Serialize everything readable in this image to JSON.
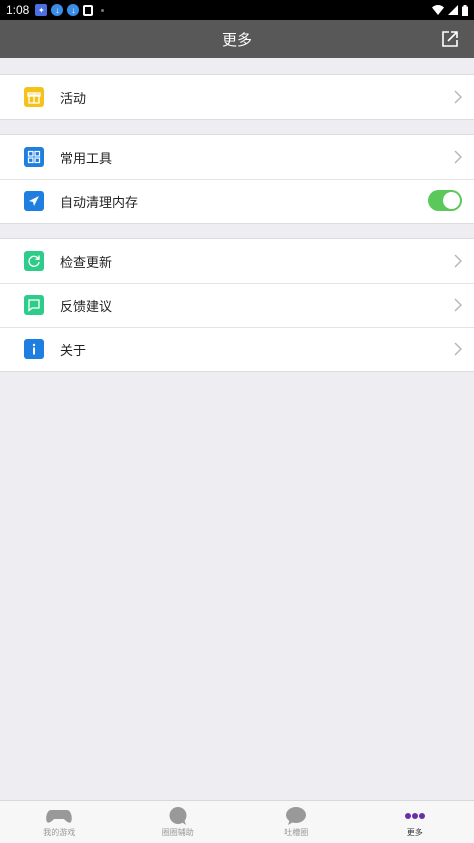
{
  "status_bar": {
    "time": "1:08"
  },
  "header": {
    "title": "更多"
  },
  "groups": [
    {
      "items": [
        {
          "label": "活动"
        }
      ]
    },
    {
      "items": [
        {
          "label": "常用工具"
        },
        {
          "label": "自动清理内存",
          "toggle_on": true
        }
      ]
    },
    {
      "items": [
        {
          "label": "检查更新"
        },
        {
          "label": "反馈建议"
        },
        {
          "label": "关于"
        }
      ]
    }
  ],
  "bottom_nav": {
    "items": [
      {
        "label": "我的游戏"
      },
      {
        "label": "圈圈辅助"
      },
      {
        "label": "吐槽圈"
      },
      {
        "label": "更多"
      }
    ],
    "active_index": 3
  },
  "colors": {
    "header_bg": "#585858",
    "activity_icon": "#f5c21b",
    "tools_icon": "#1e7fe0",
    "clean_icon": "#1e7fe0",
    "update_icon": "#2ecc8a",
    "feedback_icon": "#2ecc8a",
    "about_icon": "#1e7fe0",
    "toggle_on": "#5ac85a",
    "active_nav": "#6a2ea8"
  }
}
